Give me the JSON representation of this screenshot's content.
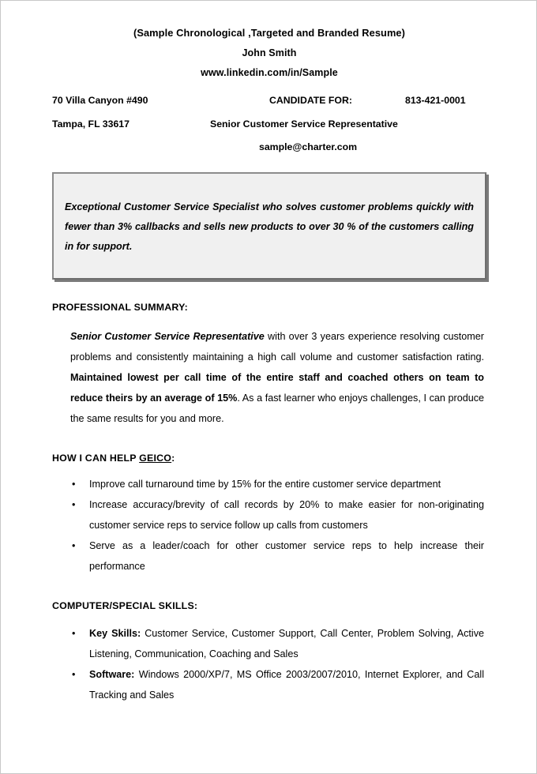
{
  "document": {
    "header": {
      "title": "(Sample Chronological ,Targeted and Branded Resume)",
      "name": "John Smith",
      "linkedin": "www.linkedin.com/in/Sample"
    },
    "contact": {
      "address_line1": "70 Villa Canyon #490",
      "address_line2": "Tampa, FL 33617",
      "candidate_for_label": "CANDIDATE FOR:",
      "phone": "813-421-0001",
      "job_title": "Senior Customer Service Representative",
      "email": "sample@charter.com"
    },
    "branding_box": {
      "text": "Exceptional Customer Service Specialist who solves customer problems quickly with fewer than 3% callbacks and sells new products to over 30 % of the customers calling in for support.",
      "background_color": "#f0f0f0",
      "border_color": "#8c8c8c",
      "shadow_color": "#7a7a7a"
    },
    "sections": {
      "professional_summary": {
        "heading": "PROFESSIONAL SUMMARY:",
        "runs": [
          {
            "style": "bold-italic",
            "text": "Senior Customer Service Representative"
          },
          {
            "style": "normal",
            "text": " with over 3 years experience resolving customer problems and consistently maintaining a high call volume and customer satisfaction rating.  "
          },
          {
            "style": "bold",
            "text": "Maintained lowest per call time of the entire staff and coached others on team to reduce theirs by an average of 15%"
          },
          {
            "style": "normal",
            "text": ".  As a fast learner who enjoys challenges, I can produce  the same results for you and more."
          }
        ]
      },
      "how_i_can_help": {
        "heading_prefix": "HOW I CAN HELP ",
        "heading_underlined": "GEICO",
        "heading_suffix": ":",
        "bullets": [
          {
            "runs": [
              {
                "style": "normal",
                "text": "Improve call turnaround time by 15% for the entire customer service department"
              }
            ]
          },
          {
            "runs": [
              {
                "style": "normal",
                "text": "Increase accuracy/brevity of call records by 20% to make easier for non-originating customer service reps to service follow up calls from customers"
              }
            ]
          },
          {
            "runs": [
              {
                "style": "normal",
                "text": "Serve as a leader/coach for other customer service reps to help increase their performance"
              }
            ]
          }
        ]
      },
      "computer_special_skills": {
        "heading": "COMPUTER/SPECIAL SKILLS:",
        "bullets": [
          {
            "runs": [
              {
                "style": "bold",
                "text": "Key Skills:"
              },
              {
                "style": "normal",
                "text": " Customer Service, Customer Support, Call Center, Problem Solving, Active Listening, Communication, Coaching and Sales"
              }
            ]
          },
          {
            "runs": [
              {
                "style": "bold",
                "text": "Software:"
              },
              {
                "style": "normal",
                "text": "  Windows 2000/XP/7, MS Office 2003/2007/2010, Internet Explorer, and Call Tracking and Sales"
              }
            ]
          }
        ]
      }
    },
    "bullet_glyph": "•"
  }
}
